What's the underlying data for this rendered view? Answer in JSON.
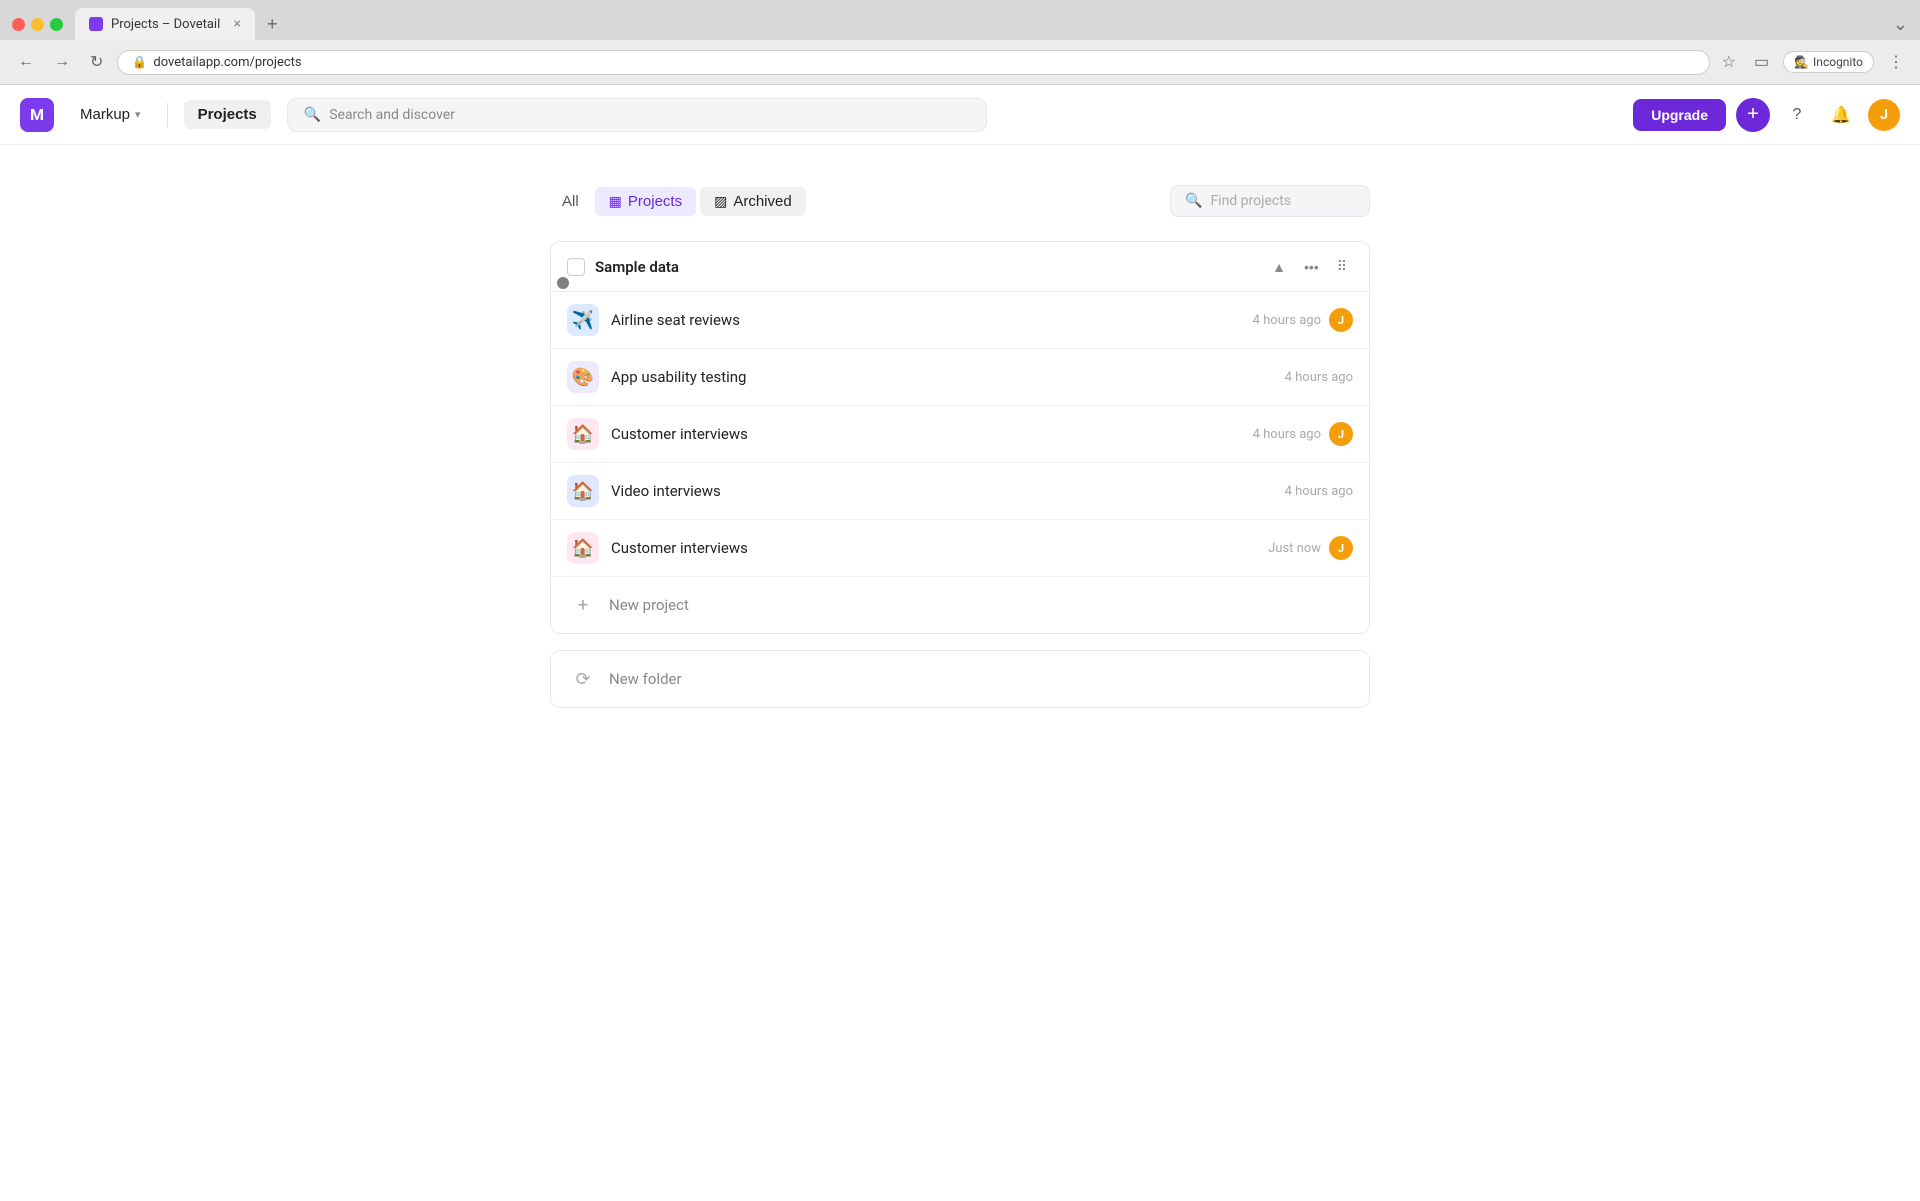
{
  "browser": {
    "tab_title": "Projects – Dovetail",
    "tab_favicon": "🔮",
    "url": "dovetailapp.com/projects",
    "nav_back": "←",
    "nav_forward": "→",
    "nav_refresh": "↻",
    "nav_new_tab": "+",
    "incognito_label": "Incognito",
    "bookmark_icon": "☆",
    "menu_icon": "⋮"
  },
  "app_nav": {
    "workspace_initial": "M",
    "workspace_name": "Markup",
    "projects_label": "Projects",
    "search_placeholder": "Search and discover",
    "upgrade_label": "Upgrade",
    "plus_icon": "+",
    "help_icon": "?",
    "notification_icon": "🔔",
    "user_initial": "J"
  },
  "filter_bar": {
    "all_label": "All",
    "projects_tab_label": "Projects",
    "archived_tab_label": "Archived",
    "find_placeholder": "Find projects",
    "projects_icon": "▦",
    "archived_icon": "▨"
  },
  "project_group": {
    "title": "Sample data",
    "collapse_icon": "▲",
    "more_icon": "•••",
    "grid_icon": "⠿",
    "projects": [
      {
        "id": "airline",
        "icon_emoji": "✈️",
        "icon_class": "airplane",
        "name": "Airline seat reviews",
        "time": "4 hours ago",
        "show_avatar": true
      },
      {
        "id": "usability",
        "icon_emoji": "🎨",
        "icon_class": "usability",
        "name": "App usability testing",
        "time": "4 hours ago",
        "show_avatar": false
      },
      {
        "id": "customer1",
        "icon_emoji": "🏠",
        "icon_class": "interviews",
        "name": "Customer interviews",
        "time": "4 hours ago",
        "show_avatar": true
      },
      {
        "id": "video",
        "icon_emoji": "🏠",
        "icon_class": "video",
        "name": "Video interviews",
        "time": "4 hours ago",
        "show_avatar": false
      },
      {
        "id": "customer2",
        "icon_emoji": "🏠",
        "icon_class": "customer2",
        "name": "Customer interviews",
        "time": "Just now",
        "show_avatar": true
      }
    ],
    "new_project_label": "New project",
    "new_folder_label": "New folder"
  }
}
